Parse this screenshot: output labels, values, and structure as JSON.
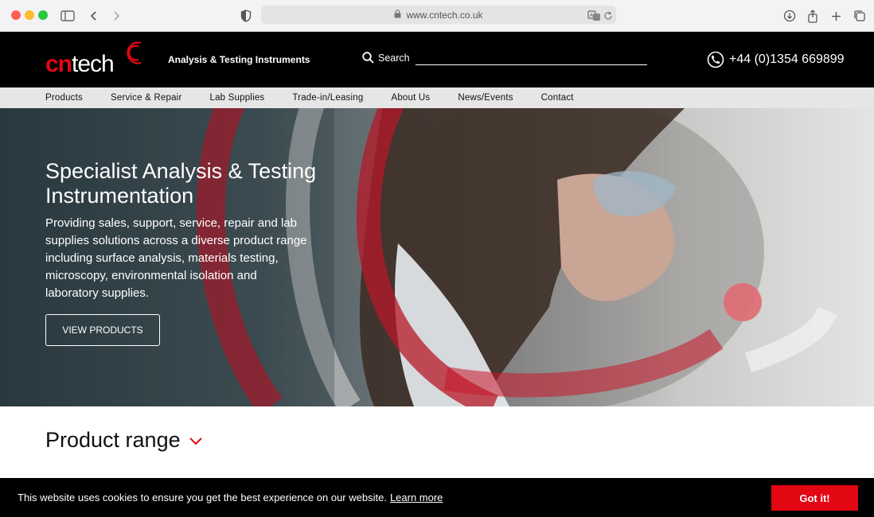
{
  "browser": {
    "url": "www.cntech.co.uk",
    "icons": [
      "sidebar-icon",
      "back-icon",
      "forward-icon",
      "shield-icon",
      "translate-icon",
      "reload-icon",
      "download-icon",
      "share-icon",
      "new-tab-icon",
      "tabs-icon"
    ]
  },
  "header": {
    "logo_text_red": "cn",
    "logo_text_white": "tech",
    "tagline": "Analysis & Testing Instruments",
    "search_label": "Search",
    "phone": "+44 (0)1354 669899"
  },
  "nav": {
    "items": [
      "Products",
      "Service & Repair",
      "Lab Supplies",
      "Trade-in/Leasing",
      "About Us",
      "News/Events",
      "Contact"
    ]
  },
  "hero": {
    "title": "Specialist Analysis & Testing Instrumentation",
    "description": "Providing sales, support, service, repair and lab supplies solutions across a diverse product range including surface analysis, materials testing, microscopy, environmental isolation and laboratory supplies.",
    "button_label": "VIEW PRODUCTS"
  },
  "product_range": {
    "heading": "Product range"
  },
  "cookie": {
    "text": "This website uses cookies to ensure you get the best experience on our website.",
    "link": "Learn more",
    "button": "Got it!"
  },
  "colors": {
    "brand_red": "#e30613",
    "header_bg": "#000000",
    "nav_bg": "#e6e6e6"
  }
}
